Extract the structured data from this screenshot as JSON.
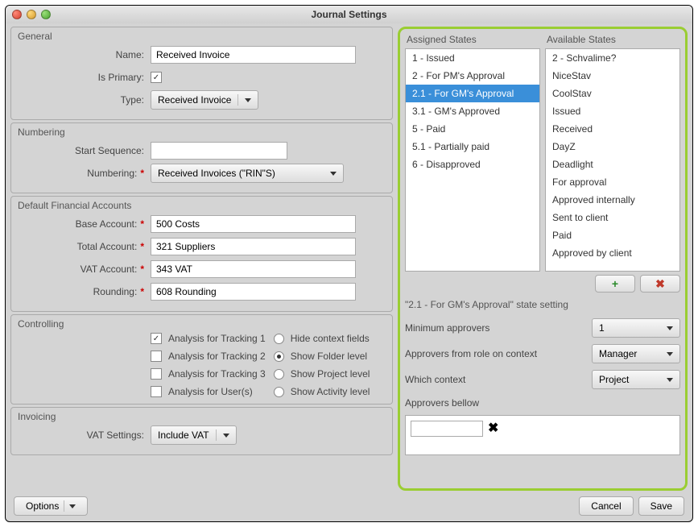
{
  "window": {
    "title": "Journal Settings"
  },
  "general": {
    "title": "General",
    "name_label": "Name:",
    "name_value": "Received Invoice",
    "is_primary_label": "Is Primary:",
    "is_primary_checked": true,
    "type_label": "Type:",
    "type_value": "Received Invoice"
  },
  "numbering": {
    "title": "Numbering",
    "start_seq_label": "Start Sequence:",
    "start_seq_value": "",
    "numbering_label": "Numbering:",
    "numbering_value": "Received Invoices (\"RIN\"S)"
  },
  "accounts": {
    "title": "Default Financial Accounts",
    "base_label": "Base Account:",
    "base_value": "500 Costs",
    "total_label": "Total Account:",
    "total_value": "321 Suppliers",
    "vat_label": "VAT Account:",
    "vat_value": "343 VAT",
    "rounding_label": "Rounding:",
    "rounding_value": "608 Rounding"
  },
  "controlling": {
    "title": "Controlling",
    "track1": "Analysis for Tracking 1",
    "track2": "Analysis for Tracking 2",
    "track3": "Analysis for Tracking 3",
    "users": "Analysis for User(s)",
    "hide_context": "Hide context fields",
    "show_folder": "Show Folder level",
    "show_project": "Show Project level",
    "show_activity": "Show Activity level",
    "track1_checked": true,
    "track2_checked": false,
    "track3_checked": false,
    "users_checked": false,
    "radio_selected": "show_folder"
  },
  "invoicing": {
    "title": "Invoicing",
    "vat_settings_label": "VAT Settings:",
    "vat_settings_value": "Include VAT"
  },
  "states": {
    "assigned_title": "Assigned States",
    "available_title": "Available States",
    "assigned": [
      "1 - Issued",
      "2 - For PM's Approval",
      "2.1 - For GM's Approval",
      "3.1 - GM's Approved",
      "5 - Paid",
      "5.1 - Partially paid",
      "6 - Disapproved"
    ],
    "assigned_selected_index": 2,
    "available": [
      "2 - Schvalime?",
      "NiceStav",
      "CoolStav",
      "Issued",
      "Received",
      "DayZ",
      "Deadlight",
      "For approval",
      "Approved internally",
      "Sent to client",
      "Paid",
      "Approved by client"
    ],
    "add_icon": "+",
    "remove_icon": "✖"
  },
  "state_setting": {
    "title": "\"2.1 - For GM's Approval\" state setting",
    "min_approvers_label": "Minimum approvers",
    "min_approvers_value": "1",
    "role_label": "Approvers from role on context",
    "role_value": "Manager",
    "context_label": "Which context",
    "context_value": "Project",
    "bellow_label": "Approvers bellow",
    "approver_input_value": "",
    "x_icon": "✖"
  },
  "footer": {
    "options": "Options",
    "cancel": "Cancel",
    "save": "Save"
  }
}
